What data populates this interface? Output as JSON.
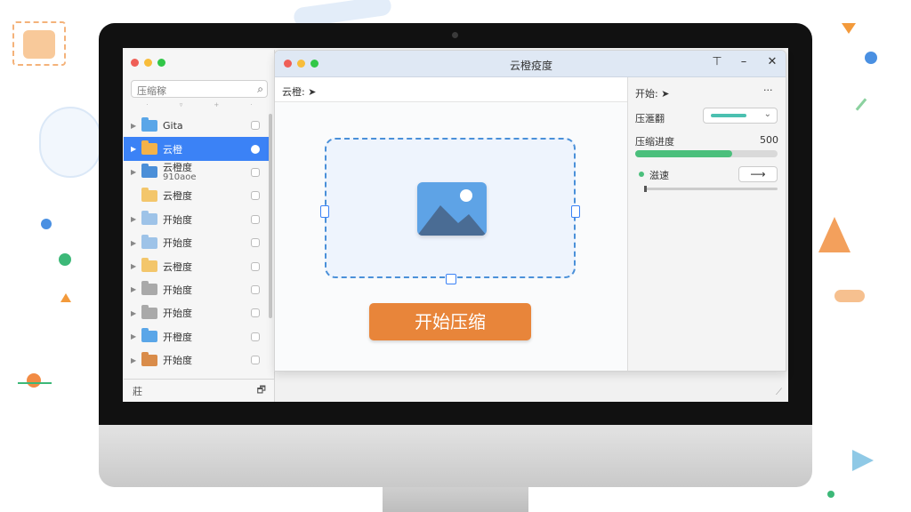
{
  "finder": {
    "search_placeholder": "压缩稼",
    "items": [
      {
        "label": "Gita",
        "color": "#5aa6e8",
        "selected": false,
        "chevron": true
      },
      {
        "label": "云橙",
        "color": "#f3b24a",
        "selected": true,
        "chevron": true
      },
      {
        "label": "云橙度",
        "sub": "910aoe",
        "color": "#4b8fd8",
        "selected": false,
        "chevron": true
      },
      {
        "label": "云橙度",
        "color": "#f3c66b",
        "selected": false,
        "chevron": false
      },
      {
        "label": "开始度",
        "color": "#9ec3e8",
        "selected": false,
        "chevron": true
      },
      {
        "label": "开始度",
        "color": "#9ec3e8",
        "selected": false,
        "chevron": true
      },
      {
        "label": "云橙度",
        "color": "#f3c66b",
        "selected": false,
        "chevron": true
      },
      {
        "label": "开始度",
        "color": "#a9a9a9",
        "selected": false,
        "chevron": true
      },
      {
        "label": "开始度",
        "color": "#a9a9a9",
        "selected": false,
        "chevron": true
      },
      {
        "label": "开橙度",
        "color": "#5aa6e8",
        "selected": false,
        "chevron": true
      },
      {
        "label": "开始度",
        "color": "#d98c4a",
        "selected": false,
        "chevron": true
      }
    ],
    "bottom_left": "莊",
    "bottom_right": "🗗"
  },
  "main": {
    "title": "云橙疫度",
    "breadcrumb": "云橙: ➤",
    "start_button": "开始压缩"
  },
  "panel": {
    "header": "开始: ➤",
    "more": "···",
    "compress_label": "压滙翻",
    "progress_label": "压缩进度",
    "progress_value": "500",
    "progress_fraction": 0.68,
    "option_label": "滋速",
    "arrow": "⟶"
  }
}
